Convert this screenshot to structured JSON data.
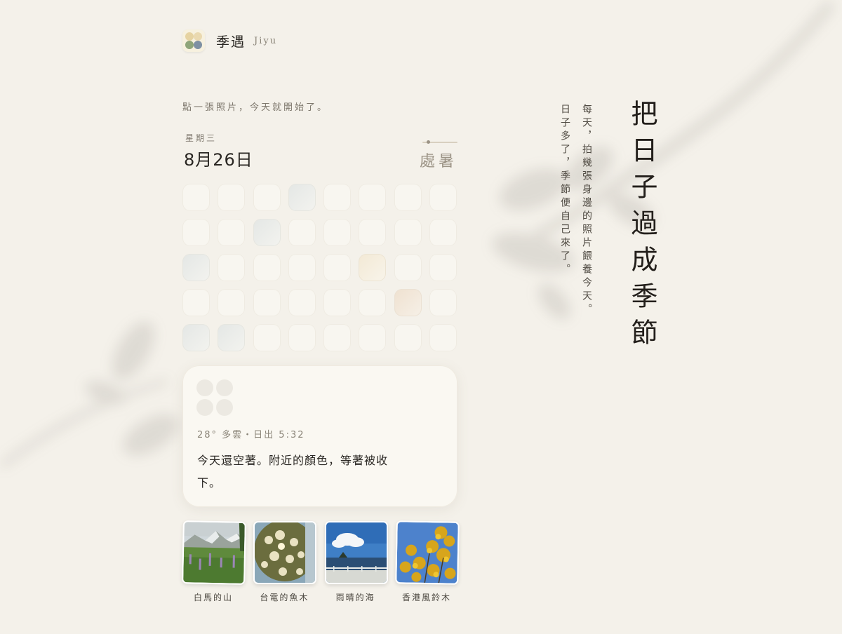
{
  "brand": {
    "name": "季遇",
    "latin": "Jiyu"
  },
  "tagline": "點一張照片，今天就開始了。",
  "date": {
    "weekday": "星期三",
    "display": "8月26日",
    "solar_term": "處暑"
  },
  "today": {
    "weather": "28° 多雲・日出 5:32",
    "message": "今天還空著。附近的顏色，等著被收下。"
  },
  "photos": [
    {
      "caption": "白馬的山"
    },
    {
      "caption": "台電的魚木"
    },
    {
      "caption": "雨晴的海"
    },
    {
      "caption": "香港風鈴木"
    }
  ],
  "intro": {
    "headline": "把日子過成季節",
    "line1": "每天，拍幾張身邊的照片餵養今天。",
    "line2": "日子多了，季節便自己來了。"
  },
  "colors": {
    "background": "#f4f1ea",
    "text": "#2f2c27",
    "muted": "#9b9385"
  }
}
